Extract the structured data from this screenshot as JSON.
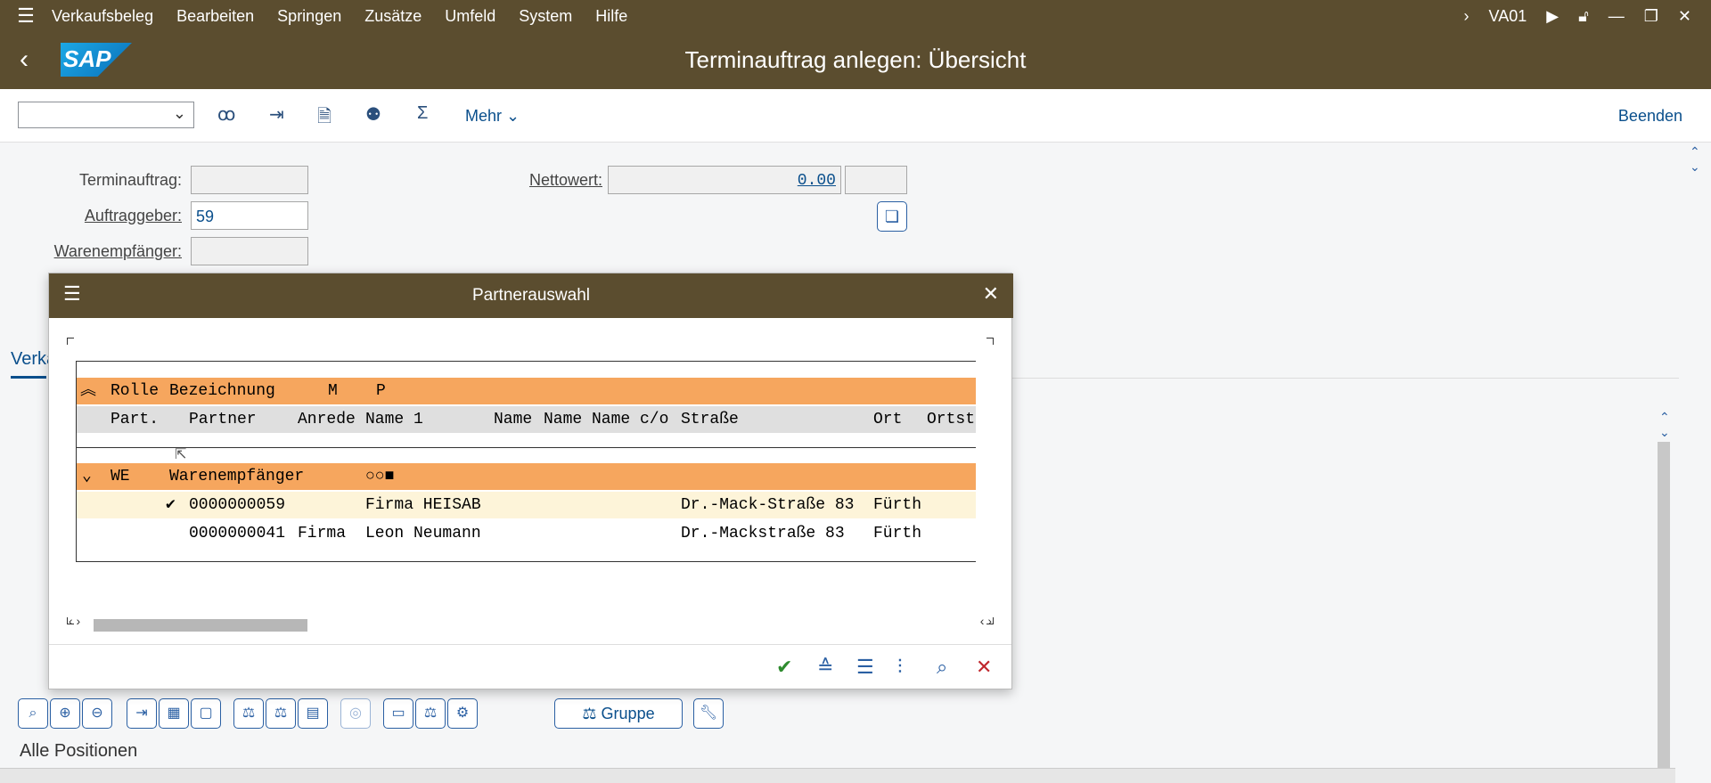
{
  "menubar": {
    "items": [
      "Verkaufsbeleg",
      "Bearbeiten",
      "Springen",
      "Zusätze",
      "Umfeld",
      "System",
      "Hilfe"
    ],
    "transaction": "VA01"
  },
  "title": "Terminauftrag anlegen: Übersicht",
  "logo": "SAP",
  "toolbar": {
    "more_label": "Mehr",
    "end_label": "Beenden"
  },
  "header": {
    "terminauftrag_label": "Terminauftrag:",
    "terminauftrag_value": "",
    "auftraggeber_label": "Auftraggeber:",
    "auftraggeber_value": "59",
    "warenempfaenger_label": "Warenempfänger:",
    "warenempfaenger_value": "",
    "nettowert_label": "Nettowert:",
    "nettowert_value": "0.00",
    "currency_value": ""
  },
  "tab_label": "Verka",
  "dialog": {
    "title": "Partnerauswahl",
    "header_row1": [
      "Rolle",
      "Bezeichnung",
      "M",
      "P"
    ],
    "header_row2": [
      "Part.",
      "Partner",
      "Anrede",
      "Name 1",
      "Name",
      "Name",
      "Name c/o",
      "Straße",
      "Ort",
      "Ortst"
    ],
    "group": {
      "code": "WE",
      "label": "Warenempfänger",
      "indicator": "○○■"
    },
    "rows": [
      {
        "check": "✔",
        "partner": "0000000059",
        "anrede": "",
        "name1": "Firma HEISAB",
        "strasse": "Dr.-Mack-Straße 83",
        "ort": "Fürth"
      },
      {
        "check": "",
        "partner": "0000000041",
        "anrede": "Firma",
        "name1": "Leon Neumann",
        "strasse": "Dr.-Mackstraße 83",
        "ort": "Fürth"
      }
    ]
  },
  "bottom": {
    "group_label": "Gruppe",
    "all_positions": "Alle Positionen"
  },
  "colors": {
    "shell": "#5b4d2f",
    "tree_header": "#f6a65e",
    "selected_row": "#fdf4d9",
    "accent": "#0a4f8c"
  }
}
